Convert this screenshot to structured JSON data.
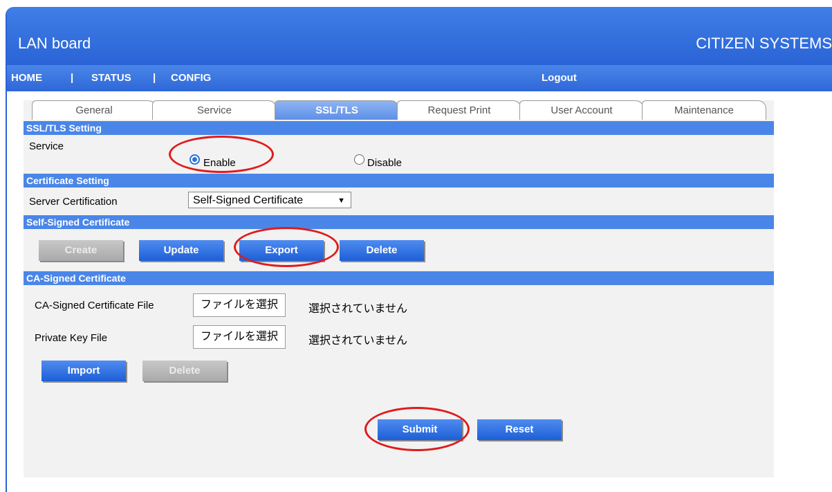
{
  "header": {
    "title": "LAN board",
    "brand": "CITIZEN SYSTEMS"
  },
  "nav": {
    "home": "HOME",
    "status": "STATUS",
    "config": "CONFIG",
    "separator": "|",
    "logout": "Logout"
  },
  "tabs": [
    "General",
    "Service",
    "SSL/TLS",
    "Request Print",
    "User Account",
    "Maintenance"
  ],
  "active_tab": "SSL/TLS",
  "ssl_tls_setting": {
    "heading": "SSL/TLS Setting",
    "service_label": "Service",
    "enable_label": "Enable",
    "disable_label": "Disable",
    "selected": "Enable"
  },
  "certificate_setting": {
    "heading": "Certificate Setting",
    "server_cert_label": "Server Certification",
    "server_cert_value": "Self-Signed Certificate"
  },
  "self_signed": {
    "heading": "Self-Signed Certificate",
    "create": "Create",
    "update": "Update",
    "export": "Export",
    "delete": "Delete"
  },
  "ca_signed": {
    "heading": "CA-Signed Certificate",
    "cert_file_label": "CA-Signed Certificate File",
    "key_file_label": "Private Key File",
    "choose_file": "ファイルを選択",
    "no_file": "選択されていません",
    "import": "Import",
    "delete": "Delete"
  },
  "form": {
    "submit": "Submit",
    "reset": "Reset"
  },
  "colors": {
    "accent": "#2a63d6",
    "section_bar": "#4a86e8",
    "highlight": "#e01b1b"
  },
  "icons": {
    "dropdown": "triangle-down"
  }
}
